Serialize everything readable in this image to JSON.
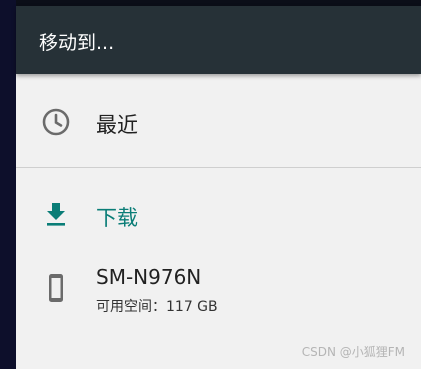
{
  "header": {
    "title": "移动到..."
  },
  "roots": [
    {
      "label": "最近",
      "icon": "clock-icon"
    },
    {
      "label": "下载",
      "icon": "download-icon",
      "color": "#0a7d77"
    },
    {
      "label": "SM-N976N",
      "summary": "可用空间：117 GB",
      "icon": "phone-icon"
    }
  ],
  "watermark": "CSDN @小狐狸FM",
  "colors": {
    "title_bar": "#263137",
    "background": "#f1f1f1",
    "accent": "#0a7d77",
    "icon_gray": "#6b6b6b"
  }
}
